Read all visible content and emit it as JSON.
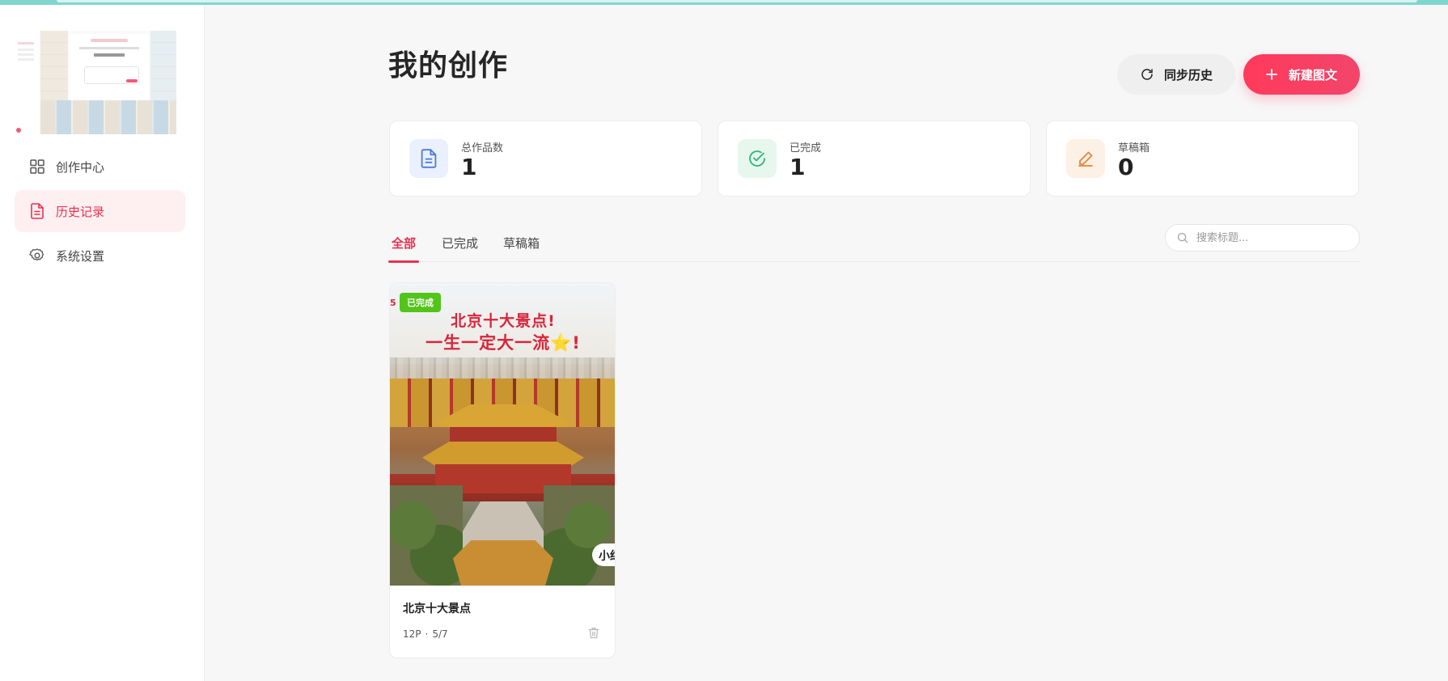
{
  "sidebar": {
    "items": [
      {
        "label": "创作中心",
        "icon": "grid-icon"
      },
      {
        "label": "历史记录",
        "icon": "document-icon",
        "active": true
      },
      {
        "label": "系统设置",
        "icon": "gear-icon"
      }
    ]
  },
  "header": {
    "title": "我的创作",
    "sync_label": "同步历史",
    "new_label": "新建图文"
  },
  "stats": [
    {
      "label": "总作品数",
      "value": "1",
      "icon": "document-icon",
      "color": "#4a7bdc"
    },
    {
      "label": "已完成",
      "value": "1",
      "icon": "check-circle-icon",
      "color": "#2bb673"
    },
    {
      "label": "草稿箱",
      "value": "0",
      "icon": "pencil-icon",
      "color": "#e8813a"
    }
  ],
  "tabs": [
    {
      "label": "全部",
      "active": true
    },
    {
      "label": "已完成"
    },
    {
      "label": "草稿箱"
    }
  ],
  "search": {
    "placeholder": "搜索标题..."
  },
  "works": [
    {
      "status": "已完成",
      "cover_line1": "北京十大景点!",
      "cover_line2": "一生一定大一流⭐!",
      "cover_tag": "小红",
      "title": "北京十大景点",
      "pages": "12P",
      "date": "5/7"
    }
  ],
  "colors": {
    "accent": "#e8324f",
    "success": "#52c41a",
    "top_strip": "#7fd6cf"
  }
}
